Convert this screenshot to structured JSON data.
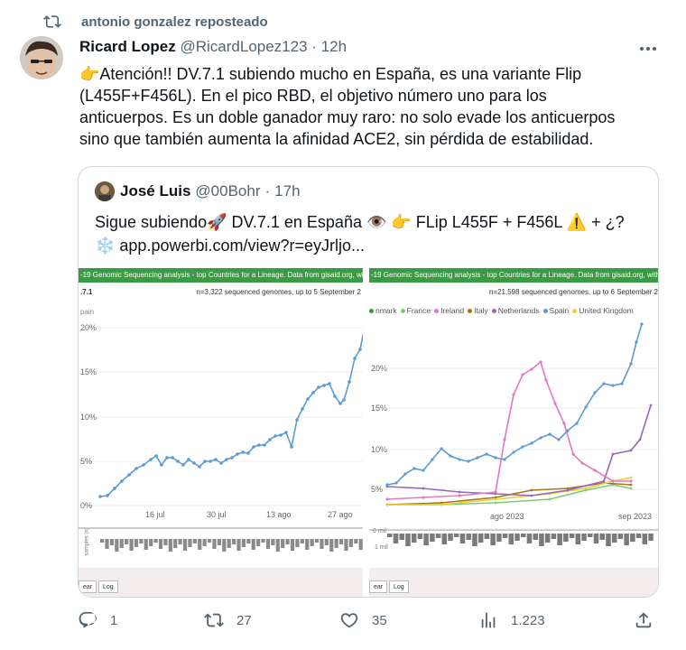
{
  "repost": {
    "label": "antonio gonzalez reposteado"
  },
  "tweet": {
    "author_name": "Ricard Lopez",
    "handle": "@RicardLopez123",
    "separator": "·",
    "time": "12h",
    "lines": [
      "👉Atención!!  DV.7.1 subiendo mucho en España, es una variante Flip",
      "(L455F+F456L). En el pico RBD, el objetivo número uno para los",
      "anticuerpos. Es un doble ganador muy raro: no solo evade los anticuerpos",
      "sino que también aumenta la afinidad ACE2, sin pérdida de estabilidad."
    ]
  },
  "quote": {
    "author_name": "José Luis",
    "handle": "@00Bohr",
    "separator": "·",
    "time": "17h",
    "lines": [
      "Sigue subiendo🚀 DV.7.1 en España 👁️ 👉 FLip L455F + F456L ⚠️ + ¿?",
      "❄️ app.powerbi.com/view?r=eyJrljo..."
    ]
  },
  "left_panel": {
    "banner": "-19 Genomic Sequencing analysis - top Countries for a Lineage. Data from gisaid.org, with nextclade line",
    "lineage": ".7.1",
    "sequenced_note": "n=3,322 sequenced genomes, up to 5 September 2",
    "country": "pain",
    "y_ticks": [
      "20%",
      "15%",
      "10%",
      "5%",
      "0%"
    ],
    "x_ticks": [
      "16 jul",
      "30 jul",
      "13 ago",
      "27 ago"
    ],
    "samples_label": "samples (n)",
    "btn_left": "ear",
    "btn_log": "Log"
  },
  "right_panel": {
    "banner": "-19 Genomic Sequencing analysis - top Countries for a Lineage. Data from gisaid.org, with nextclade line",
    "sequenced_note": "n=21,598 sequenced genomes, up to 6 September 2",
    "y_ticks": [
      "20%",
      "15%",
      "10%",
      "5%"
    ],
    "x_ticks": [
      "ago 2023",
      "sep 2023"
    ],
    "sample_ticks": [
      "0 mil",
      "1 mil"
    ],
    "btn_left": "ear",
    "btn_log": "Log",
    "legend": [
      {
        "name": "nmark",
        "color": "#2ca02c"
      },
      {
        "name": "France",
        "color": "#7fc97f"
      },
      {
        "name": "Ireland",
        "color": "#e377c2"
      },
      {
        "name": "Italy",
        "color": "#a6761d"
      },
      {
        "name": "Netherlands",
        "color": "#9467bd"
      },
      {
        "name": "Spain",
        "color": "#5b9bd5"
      },
      {
        "name": "United Kingdom",
        "color": "#e6d22e"
      }
    ]
  },
  "actions": {
    "replies": "1",
    "reposts": "27",
    "likes": "35",
    "views": "1.223"
  }
}
